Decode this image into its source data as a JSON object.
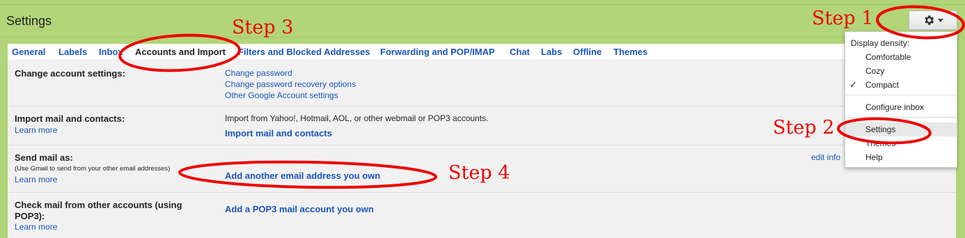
{
  "header": {
    "title": "Settings"
  },
  "tabs": [
    {
      "label": "General"
    },
    {
      "label": "Labels"
    },
    {
      "label": "Inbox"
    },
    {
      "label": "Accounts and Import"
    },
    {
      "label": "Filters and Blocked Addresses"
    },
    {
      "label": "Forwarding and POP/IMAP"
    },
    {
      "label": "Chat"
    },
    {
      "label": "Labs"
    },
    {
      "label": "Offline"
    },
    {
      "label": "Themes"
    }
  ],
  "rows": {
    "change_account": {
      "label": "Change account settings:",
      "links": [
        "Change password",
        "Change password recovery options",
        "Other Google Account settings"
      ]
    },
    "import": {
      "label": "Import mail and contacts:",
      "learn_more": "Learn more",
      "text": "Import from Yahoo!, Hotmail, AOL, or other webmail or POP3 accounts.",
      "action": "Import mail and contacts"
    },
    "send_as": {
      "label": "Send mail as:",
      "sublabel": "(Use Gmail to send from your other email addresses)",
      "learn_more": "Learn more",
      "action": "Add another email address you own",
      "edit_info": "edit info"
    },
    "check_mail": {
      "label_line1": "Check mail from other accounts (using",
      "label_line2": "POP3):",
      "learn_more": "Learn more",
      "action": "Add a POP3 mail account you own"
    }
  },
  "menu": {
    "heading": "Display density:",
    "density": [
      "Comfortable",
      "Cozy",
      "Compact"
    ],
    "selected_density": "Compact",
    "items": [
      "Configure inbox",
      "Settings",
      "Themes",
      "Help"
    ]
  },
  "annotations": {
    "step1": "Step 1",
    "step2": "Step 2",
    "step3": "Step 3",
    "step4": "Step 4",
    "color": "#e00000"
  },
  "colors": {
    "background": "#b2d57a",
    "link": "#1a55b8"
  },
  "icons": {
    "gear": "gear-icon",
    "dropdown": "chevron-down-icon",
    "check": "checkmark-icon"
  }
}
